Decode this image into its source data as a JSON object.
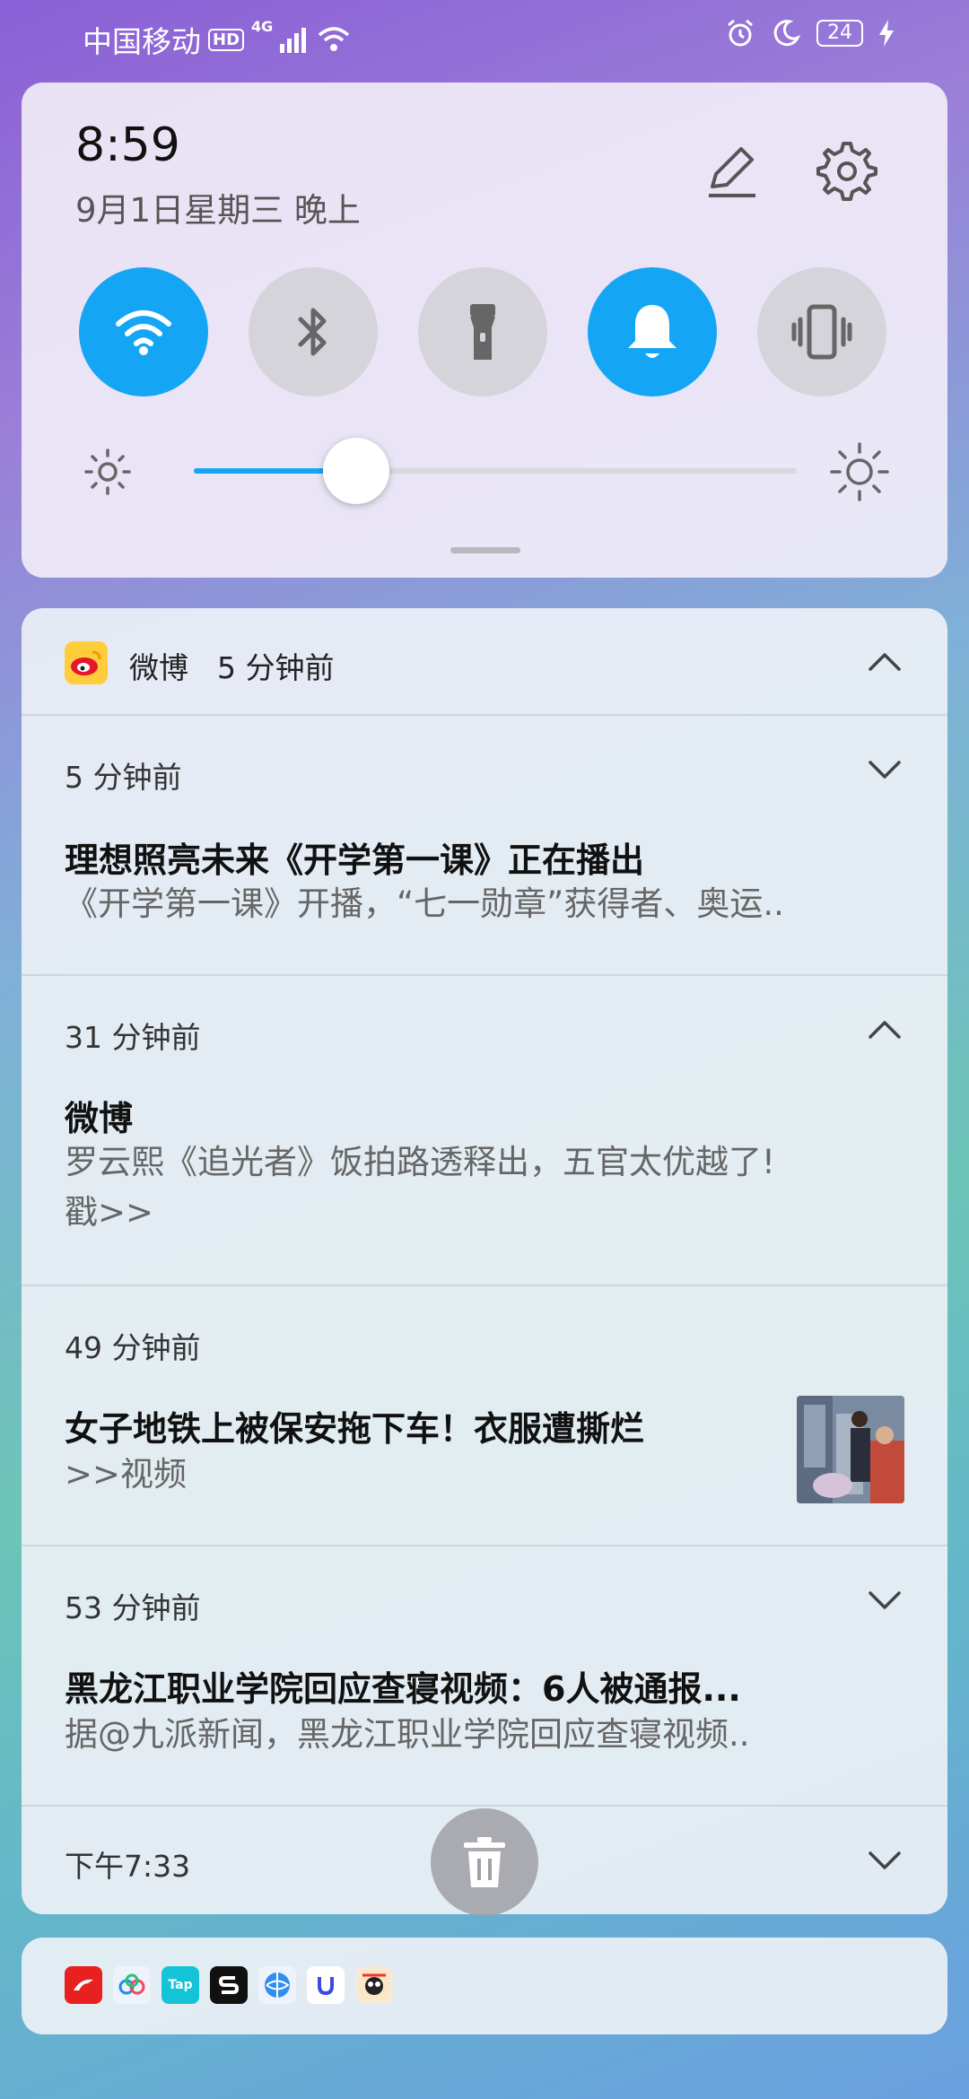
{
  "status_bar": {
    "carrier": "中国移动",
    "hd_label": "HD",
    "network": "4G",
    "battery": "24"
  },
  "quick_settings": {
    "time": "8:59",
    "date": "9月1日星期三 晚上",
    "tiles": [
      {
        "name": "wifi",
        "on": true
      },
      {
        "name": "bluetooth",
        "on": false
      },
      {
        "name": "flashlight",
        "on": false
      },
      {
        "name": "sound",
        "on": true
      },
      {
        "name": "vibrate",
        "on": false
      }
    ],
    "brightness_fraction": 0.27,
    "accent_color": "#14a6f5"
  },
  "notifications": {
    "app_name": "微博",
    "app_time": "5 分钟前",
    "items": [
      {
        "time": "5 分钟前",
        "title": "理想照亮未来《开学第一课》正在播出",
        "body": "《开学第一课》开播，“七一勋章”获得者、奥运..",
        "expanded": false
      },
      {
        "time": "31 分钟前",
        "title": "微博",
        "body_line1": "罗云熙《追光者》饭拍路透释出，五官太优越了!",
        "body_line2": "戳>>",
        "expanded": true
      },
      {
        "time": "49 分钟前",
        "title": "女子地铁上被保安拖下车！衣服遭撕烂",
        "body": ">>视频"
      },
      {
        "time": "53 分钟前",
        "title": "黑龙江职业学院回应查寝视频：6人被通报...",
        "body": "据@九派新闻，黑龙江职业学院回应查寝视频..",
        "expanded": false
      },
      {
        "time": "下午7:33",
        "expanded": false
      }
    ]
  },
  "app_strip": {
    "icons": [
      "app-red-icon",
      "app-cloud-icon",
      "taptap-icon",
      "app-s-icon",
      "browser-icon",
      "app-u-icon",
      "game-icon"
    ],
    "taptap_label": "Tap"
  }
}
